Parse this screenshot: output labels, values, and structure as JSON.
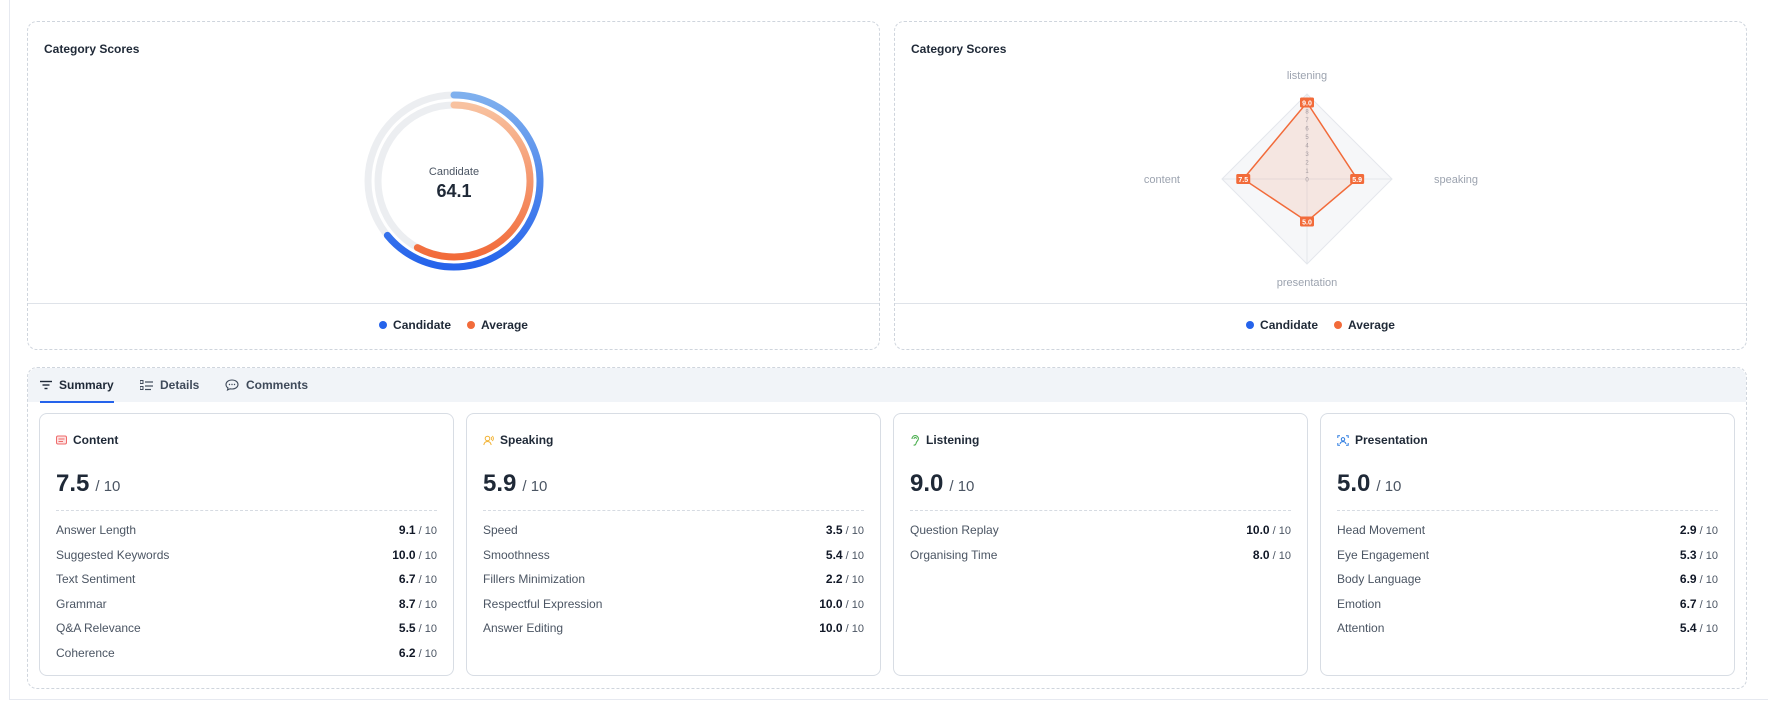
{
  "colors": {
    "candidate": "#2563eb",
    "candidate_light": "#7fb0ee",
    "average": "#f26b3a",
    "average_light": "#f8c2a0",
    "track": "#eceef1"
  },
  "donut_panel": {
    "title": "Category Scores",
    "center_label": "Candidate",
    "center_value": "64.1",
    "legend": [
      {
        "label": "Candidate",
        "color": "#2563eb"
      },
      {
        "label": "Average",
        "color": "#f26b3a"
      }
    ]
  },
  "radar_panel": {
    "title": "Category Scores",
    "legend": [
      {
        "label": "Candidate",
        "color": "#2563eb"
      },
      {
        "label": "Average",
        "color": "#f26b3a"
      }
    ]
  },
  "chart_data": [
    {
      "type": "pie",
      "title": "Category Scores",
      "center_label": "Candidate",
      "center_value": 64.1,
      "series": [
        {
          "name": "Candidate",
          "values": [
            64.1
          ],
          "max": 100
        },
        {
          "name": "Average",
          "values": [
            58
          ],
          "max": 100
        }
      ]
    },
    {
      "type": "radar",
      "title": "Category Scores",
      "categories": [
        "listening",
        "speaking",
        "presentation",
        "content"
      ],
      "rlim": [
        0,
        10
      ],
      "ticks": [
        0,
        1,
        2,
        3,
        4,
        5,
        6,
        7,
        8,
        9
      ],
      "series": [
        {
          "name": "Average",
          "values": [
            9.0,
            5.9,
            5.0,
            7.5
          ],
          "labels": [
            "9.0",
            "5.9",
            "5.0",
            "7.5"
          ]
        }
      ]
    }
  ],
  "tabs": [
    {
      "label": "Summary",
      "icon": "filter-lines-icon",
      "active": true
    },
    {
      "label": "Details",
      "icon": "list-details-icon",
      "active": false
    },
    {
      "label": "Comments",
      "icon": "chat-bubble-icon",
      "active": false
    }
  ],
  "cards": [
    {
      "title": "Content",
      "icon": "content-icon",
      "icon_color": "#ef6b6b",
      "score": "7.5",
      "out_of": "/ 10",
      "metrics": [
        {
          "label": "Answer Length",
          "value": "9.1",
          "of": "/ 10"
        },
        {
          "label": "Suggested Keywords",
          "value": "10.0",
          "of": "/ 10"
        },
        {
          "label": "Text Sentiment",
          "value": "6.7",
          "of": "/ 10"
        },
        {
          "label": "Grammar",
          "value": "8.7",
          "of": "/ 10"
        },
        {
          "label": "Q&A Relevance",
          "value": "5.5",
          "of": "/ 10"
        },
        {
          "label": "Coherence",
          "value": "6.2",
          "of": "/ 10"
        }
      ]
    },
    {
      "title": "Speaking",
      "icon": "speaking-icon",
      "icon_color": "#f2b233",
      "score": "5.9",
      "out_of": "/ 10",
      "metrics": [
        {
          "label": "Speed",
          "value": "3.5",
          "of": "/ 10"
        },
        {
          "label": "Smoothness",
          "value": "5.4",
          "of": "/ 10"
        },
        {
          "label": "Fillers Minimization",
          "value": "2.2",
          "of": "/ 10"
        },
        {
          "label": "Respectful Expression",
          "value": "10.0",
          "of": "/ 10"
        },
        {
          "label": "Answer Editing",
          "value": "10.0",
          "of": "/ 10"
        }
      ]
    },
    {
      "title": "Listening",
      "icon": "listening-icon",
      "icon_color": "#4caf50",
      "score": "9.0",
      "out_of": "/ 10",
      "metrics": [
        {
          "label": "Question Replay",
          "value": "10.0",
          "of": "/ 10"
        },
        {
          "label": "Organising Time",
          "value": "8.0",
          "of": "/ 10"
        }
      ]
    },
    {
      "title": "Presentation",
      "icon": "presentation-icon",
      "icon_color": "#2f7de1",
      "score": "5.0",
      "out_of": "/ 10",
      "metrics": [
        {
          "label": "Head Movement",
          "value": "2.9",
          "of": "/ 10"
        },
        {
          "label": "Eye Engagement",
          "value": "5.3",
          "of": "/ 10"
        },
        {
          "label": "Body Language",
          "value": "6.9",
          "of": "/ 10"
        },
        {
          "label": "Emotion",
          "value": "6.7",
          "of": "/ 10"
        },
        {
          "label": "Attention",
          "value": "5.4",
          "of": "/ 10"
        }
      ]
    }
  ]
}
